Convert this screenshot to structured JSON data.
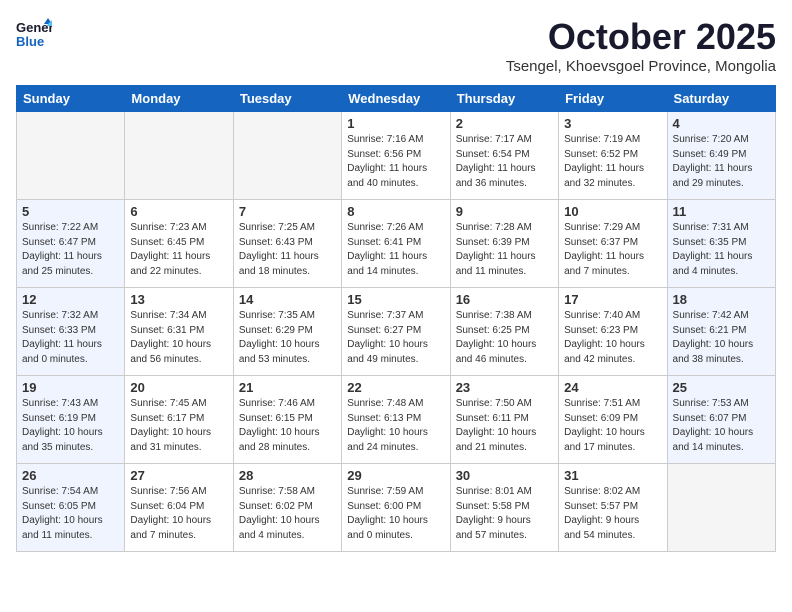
{
  "header": {
    "logo_line1": "General",
    "logo_line2": "Blue",
    "month": "October 2025",
    "location": "Tsengel, Khoevsgoel Province, Mongolia"
  },
  "weekdays": [
    "Sunday",
    "Monday",
    "Tuesday",
    "Wednesday",
    "Thursday",
    "Friday",
    "Saturday"
  ],
  "weeks": [
    [
      {
        "day": "",
        "type": "empty",
        "info": ""
      },
      {
        "day": "",
        "type": "empty",
        "info": ""
      },
      {
        "day": "",
        "type": "empty",
        "info": ""
      },
      {
        "day": "1",
        "type": "weekday",
        "info": "Sunrise: 7:16 AM\nSunset: 6:56 PM\nDaylight: 11 hours\nand 40 minutes."
      },
      {
        "day": "2",
        "type": "weekday",
        "info": "Sunrise: 7:17 AM\nSunset: 6:54 PM\nDaylight: 11 hours\nand 36 minutes."
      },
      {
        "day": "3",
        "type": "weekday",
        "info": "Sunrise: 7:19 AM\nSunset: 6:52 PM\nDaylight: 11 hours\nand 32 minutes."
      },
      {
        "day": "4",
        "type": "weekend",
        "info": "Sunrise: 7:20 AM\nSunset: 6:49 PM\nDaylight: 11 hours\nand 29 minutes."
      }
    ],
    [
      {
        "day": "5",
        "type": "weekend",
        "info": "Sunrise: 7:22 AM\nSunset: 6:47 PM\nDaylight: 11 hours\nand 25 minutes."
      },
      {
        "day": "6",
        "type": "weekday",
        "info": "Sunrise: 7:23 AM\nSunset: 6:45 PM\nDaylight: 11 hours\nand 22 minutes."
      },
      {
        "day": "7",
        "type": "weekday",
        "info": "Sunrise: 7:25 AM\nSunset: 6:43 PM\nDaylight: 11 hours\nand 18 minutes."
      },
      {
        "day": "8",
        "type": "weekday",
        "info": "Sunrise: 7:26 AM\nSunset: 6:41 PM\nDaylight: 11 hours\nand 14 minutes."
      },
      {
        "day": "9",
        "type": "weekday",
        "info": "Sunrise: 7:28 AM\nSunset: 6:39 PM\nDaylight: 11 hours\nand 11 minutes."
      },
      {
        "day": "10",
        "type": "weekday",
        "info": "Sunrise: 7:29 AM\nSunset: 6:37 PM\nDaylight: 11 hours\nand 7 minutes."
      },
      {
        "day": "11",
        "type": "weekend",
        "info": "Sunrise: 7:31 AM\nSunset: 6:35 PM\nDaylight: 11 hours\nand 4 minutes."
      }
    ],
    [
      {
        "day": "12",
        "type": "weekend",
        "info": "Sunrise: 7:32 AM\nSunset: 6:33 PM\nDaylight: 11 hours\nand 0 minutes."
      },
      {
        "day": "13",
        "type": "weekday",
        "info": "Sunrise: 7:34 AM\nSunset: 6:31 PM\nDaylight: 10 hours\nand 56 minutes."
      },
      {
        "day": "14",
        "type": "weekday",
        "info": "Sunrise: 7:35 AM\nSunset: 6:29 PM\nDaylight: 10 hours\nand 53 minutes."
      },
      {
        "day": "15",
        "type": "weekday",
        "info": "Sunrise: 7:37 AM\nSunset: 6:27 PM\nDaylight: 10 hours\nand 49 minutes."
      },
      {
        "day": "16",
        "type": "weekday",
        "info": "Sunrise: 7:38 AM\nSunset: 6:25 PM\nDaylight: 10 hours\nand 46 minutes."
      },
      {
        "day": "17",
        "type": "weekday",
        "info": "Sunrise: 7:40 AM\nSunset: 6:23 PM\nDaylight: 10 hours\nand 42 minutes."
      },
      {
        "day": "18",
        "type": "weekend",
        "info": "Sunrise: 7:42 AM\nSunset: 6:21 PM\nDaylight: 10 hours\nand 38 minutes."
      }
    ],
    [
      {
        "day": "19",
        "type": "weekend",
        "info": "Sunrise: 7:43 AM\nSunset: 6:19 PM\nDaylight: 10 hours\nand 35 minutes."
      },
      {
        "day": "20",
        "type": "weekday",
        "info": "Sunrise: 7:45 AM\nSunset: 6:17 PM\nDaylight: 10 hours\nand 31 minutes."
      },
      {
        "day": "21",
        "type": "weekday",
        "info": "Sunrise: 7:46 AM\nSunset: 6:15 PM\nDaylight: 10 hours\nand 28 minutes."
      },
      {
        "day": "22",
        "type": "weekday",
        "info": "Sunrise: 7:48 AM\nSunset: 6:13 PM\nDaylight: 10 hours\nand 24 minutes."
      },
      {
        "day": "23",
        "type": "weekday",
        "info": "Sunrise: 7:50 AM\nSunset: 6:11 PM\nDaylight: 10 hours\nand 21 minutes."
      },
      {
        "day": "24",
        "type": "weekday",
        "info": "Sunrise: 7:51 AM\nSunset: 6:09 PM\nDaylight: 10 hours\nand 17 minutes."
      },
      {
        "day": "25",
        "type": "weekend",
        "info": "Sunrise: 7:53 AM\nSunset: 6:07 PM\nDaylight: 10 hours\nand 14 minutes."
      }
    ],
    [
      {
        "day": "26",
        "type": "weekend",
        "info": "Sunrise: 7:54 AM\nSunset: 6:05 PM\nDaylight: 10 hours\nand 11 minutes."
      },
      {
        "day": "27",
        "type": "weekday",
        "info": "Sunrise: 7:56 AM\nSunset: 6:04 PM\nDaylight: 10 hours\nand 7 minutes."
      },
      {
        "day": "28",
        "type": "weekday",
        "info": "Sunrise: 7:58 AM\nSunset: 6:02 PM\nDaylight: 10 hours\nand 4 minutes."
      },
      {
        "day": "29",
        "type": "weekday",
        "info": "Sunrise: 7:59 AM\nSunset: 6:00 PM\nDaylight: 10 hours\nand 0 minutes."
      },
      {
        "day": "30",
        "type": "weekday",
        "info": "Sunrise: 8:01 AM\nSunset: 5:58 PM\nDaylight: 9 hours\nand 57 minutes."
      },
      {
        "day": "31",
        "type": "weekday",
        "info": "Sunrise: 8:02 AM\nSunset: 5:57 PM\nDaylight: 9 hours\nand 54 minutes."
      },
      {
        "day": "",
        "type": "empty",
        "info": ""
      }
    ]
  ]
}
